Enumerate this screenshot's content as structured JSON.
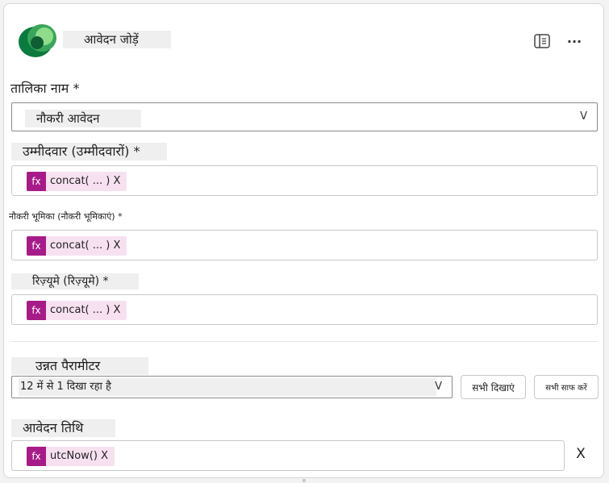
{
  "header": {
    "title": "आवेदन जोड़ें",
    "logo_icon": "dataverse-logo-icon",
    "panel_icon": "side-panel-icon",
    "more_icon": "more-options-icon",
    "more_glyph": "···"
  },
  "table_name": {
    "label": "तालिका नाम *",
    "value": "नौकरी आवेदन",
    "chevron": "V"
  },
  "candidate": {
    "label": "उम्मीदवार (उम्मीदवारों) *",
    "fx": "fx",
    "expression": "concat( ... ) X"
  },
  "job_role": {
    "label": "नौकरी भूमिका (नौकरी भूमिकाएं) *",
    "fx": "fx",
    "expression": "concat( ... ) X"
  },
  "resume": {
    "label": "रिज़्यूमे (रिज़्यूमे) *",
    "fx": "fx",
    "expression": "concat( ... ) X"
  },
  "advanced": {
    "label": "उन्नत पैरामीटर",
    "select_value": "12 में से 1 दिखा रहा है",
    "chevron": "V",
    "show_all": "सभी दिखाएं",
    "clear_all": "सभी साफ करें"
  },
  "application_date": {
    "label": "आवेदन तिथि",
    "fx": "fx",
    "expression": "utcNow() X",
    "remove": "X"
  },
  "colors": {
    "fx_badge": "#a71b89",
    "pill_bg": "#f7e1f1",
    "logo_dark": "#0b7a3e",
    "logo_light": "#55c06a"
  }
}
